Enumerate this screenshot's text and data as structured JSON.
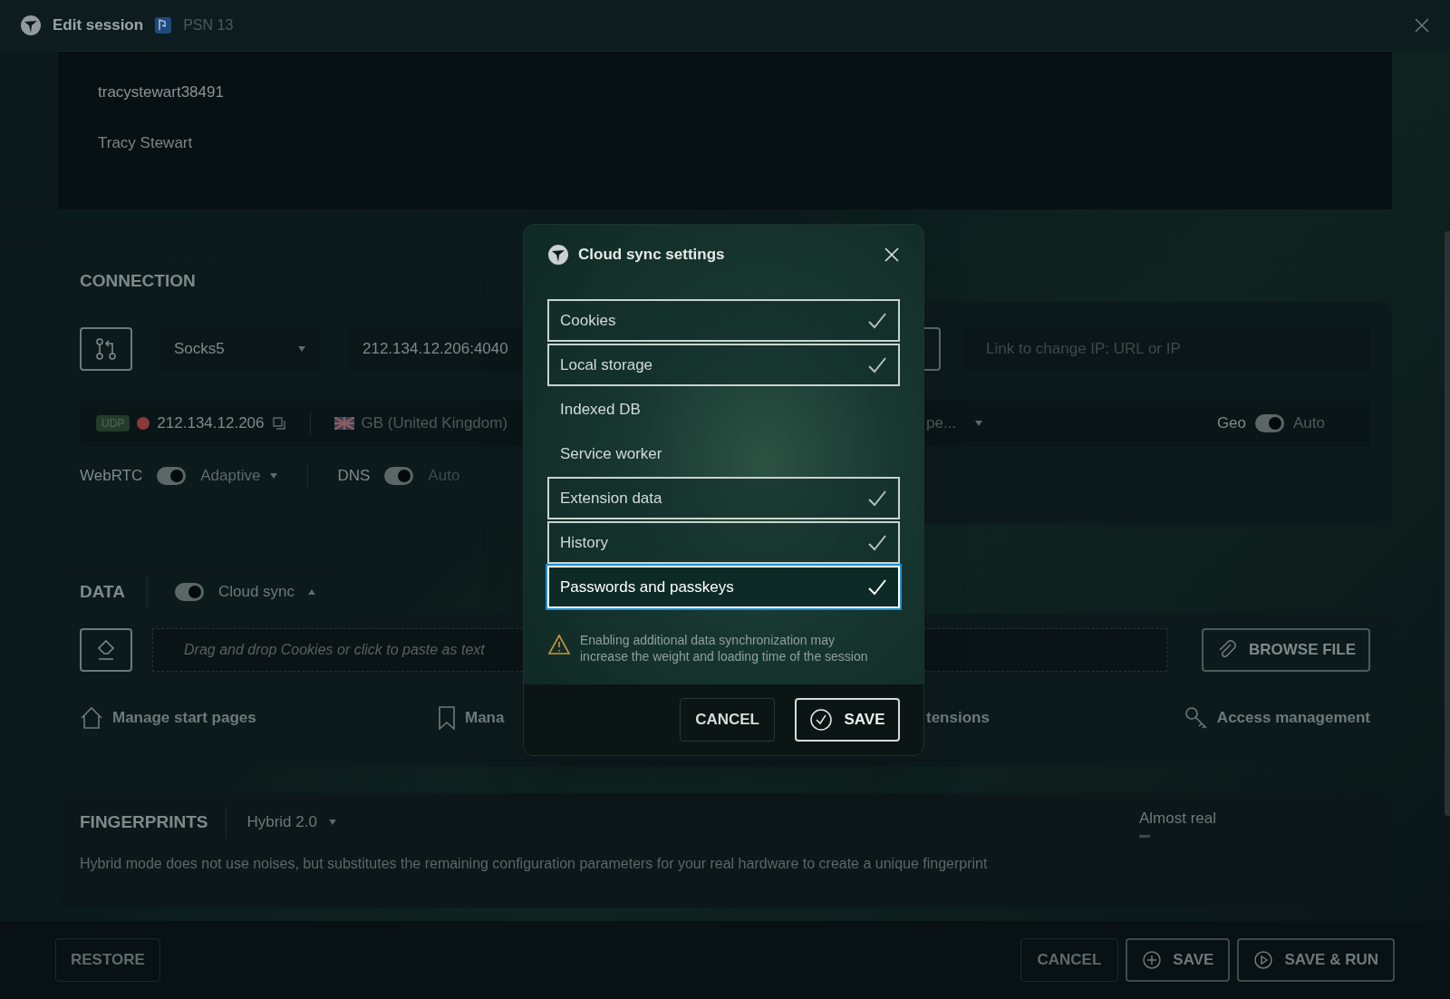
{
  "window": {
    "title": "Edit session",
    "profile": "PSN 13"
  },
  "account": {
    "login": "tracystewart38491",
    "name": "Tracy Stewart"
  },
  "connection": {
    "title": "CONNECTION",
    "proxy_type": "Socks5",
    "proxy": "212.134.12.206:4040",
    "change_ip_placeholder": "Link to change IP: URL or IP",
    "protocol": "UDP",
    "ip": "212.134.12.206",
    "country": "GB (United Kingdom)",
    "fragment": "pe...",
    "geo": {
      "label": "Geo",
      "on": true,
      "value": "Auto"
    },
    "webrtc": {
      "label": "WebRTC",
      "on": true,
      "value": "Adaptive"
    },
    "dns": {
      "label": "DNS",
      "on": true,
      "value": "Auto"
    }
  },
  "data": {
    "title": "DATA",
    "cloud_sync": {
      "label": "Cloud sync",
      "on": true
    },
    "drop_placeholder": "Drag and drop Cookies or click to paste as text",
    "browse": "BROWSE FILE",
    "links": [
      {
        "kind": "home",
        "label": "Manage start pages"
      },
      {
        "kind": "bookmark",
        "label": "Mana"
      },
      {
        "kind": "none",
        "label": "tensions"
      },
      {
        "kind": "key",
        "label": "Access management"
      }
    ]
  },
  "fingerprints": {
    "title": "FINGERPRINTS",
    "mode": "Hybrid 2.0",
    "realism": "Almost real",
    "description": "Hybrid mode does not use noises, but substitutes the remaining configuration parameters for your real hardware to create a unique fingerprint"
  },
  "footer": {
    "restore": "RESTORE",
    "cancel": "CANCEL",
    "save": "SAVE",
    "save_run": "SAVE & RUN"
  },
  "modal": {
    "title": "Cloud sync settings",
    "items": [
      {
        "label": "Cookies",
        "checked": true,
        "focused": false
      },
      {
        "label": "Local storage",
        "checked": true,
        "focused": false
      },
      {
        "label": "Indexed DB",
        "checked": false,
        "focused": false
      },
      {
        "label": "Service worker",
        "checked": false,
        "focused": false
      },
      {
        "label": "Extension data",
        "checked": true,
        "focused": false
      },
      {
        "label": "History",
        "checked": true,
        "focused": false
      },
      {
        "label": "Passwords and passkeys",
        "checked": true,
        "focused": true
      }
    ],
    "warning": "Enabling additional data synchronization may increase the weight and loading time of the session",
    "cancel": "CANCEL",
    "save": "SAVE"
  }
}
